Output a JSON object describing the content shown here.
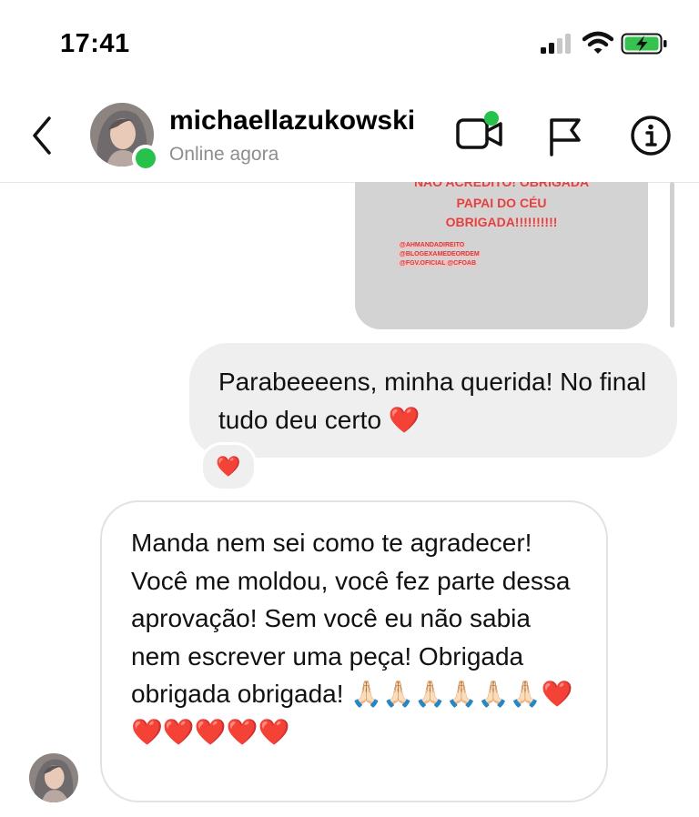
{
  "status_bar": {
    "time": "17:41"
  },
  "header": {
    "username": "michaellazukowski",
    "presence": "Online agora"
  },
  "story": {
    "line1": "NÃO ACREDITO! OBRIGADA",
    "line2": "PAPAI DO CÉU",
    "line3": "OBRIGADA!!!!!!!!!!",
    "tags": [
      "@AHMANDADIREITO",
      "@BLOGEXAMEDEORDEM",
      "@FGV.OFICIAL @CFOAB"
    ]
  },
  "messages": {
    "sent": "Parabeeeens, minha querida! No final tudo deu certo ❤️",
    "sent_reaction": "❤️",
    "received": "Manda nem sei como te agradecer! Você me moldou, você fez parte dessa aprovação! Sem você eu não sabia nem escrever uma peça! Obrigada obrigada obrigada! 🙏🏻🙏🏻🙏🏻🙏🏻🙏🏻🙏🏻❤️❤️❤️❤️❤️❤️"
  },
  "colors": {
    "online": "#27c24c",
    "sent_bubble": "#efefef",
    "heart": "#e0162b",
    "story_text": "#d84545"
  },
  "icons": [
    "back-chevron-icon",
    "video-call-icon",
    "report-flag-icon",
    "info-icon",
    "signal-icon",
    "wifi-icon",
    "battery-charging-icon"
  ]
}
